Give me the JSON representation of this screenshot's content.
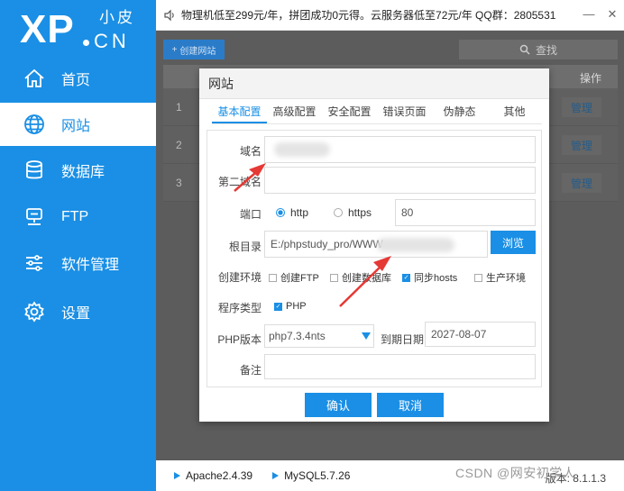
{
  "logo": {
    "xp": "XP",
    "cn": "CN",
    "xiaopi": "小皮"
  },
  "sidebar": {
    "items": [
      {
        "label": "首页",
        "icon": "home-icon"
      },
      {
        "label": "网站",
        "icon": "globe-icon",
        "active": true
      },
      {
        "label": "数据库",
        "icon": "database-icon"
      },
      {
        "label": "FTP",
        "icon": "ftp-icon"
      },
      {
        "label": "软件管理",
        "icon": "sliders-icon"
      },
      {
        "label": "设置",
        "icon": "gear-icon"
      }
    ]
  },
  "topbar": {
    "notice": "物理机低至299元/年，拼团成功0元得。云服务器低至72元/年  QQ群：2805531"
  },
  "main": {
    "create_label": "创建网站",
    "search_label": "查找",
    "op_header": "操作",
    "rows": [
      {
        "num": "1",
        "action": "管理"
      },
      {
        "num": "2",
        "action": "管理"
      },
      {
        "num": "3",
        "action": "管理"
      }
    ]
  },
  "dialog": {
    "title": "网站",
    "tabs": [
      "基本配置",
      "高级配置",
      "安全配置",
      "错误页面",
      "伪静态",
      "其他"
    ],
    "domain_label": "域名",
    "second_domain_label": "第二域名",
    "port_label": "端口",
    "http_label": "http",
    "https_label": "https",
    "port_value": "80",
    "root_label": "根目录",
    "root_value": "E:/phpstudy_pro/WWW",
    "browse_label": "浏览",
    "env_label": "创建环境",
    "env_options": [
      {
        "label": "创建FTP",
        "checked": false
      },
      {
        "label": "创建数据库",
        "checked": false
      },
      {
        "label": "同步hosts",
        "checked": true
      },
      {
        "label": "生产环境",
        "checked": false
      }
    ],
    "program_label": "程序类型",
    "program_option": "PHP",
    "php_version_label": "PHP版本",
    "php_version_value": "php7.3.4nts",
    "expiry_label": "到期日期",
    "expiry_value": "2027-08-07",
    "note_label": "备注",
    "confirm_label": "确认",
    "cancel_label": "取消"
  },
  "bottombar": {
    "apache": "Apache2.4.39",
    "mysql": "MySQL5.7.26",
    "version": "版本: 8.1.1.3"
  },
  "watermark": "CSDN @网安初学人",
  "colors": {
    "accent": "#1a8fe5",
    "annotation": "#e53935"
  }
}
